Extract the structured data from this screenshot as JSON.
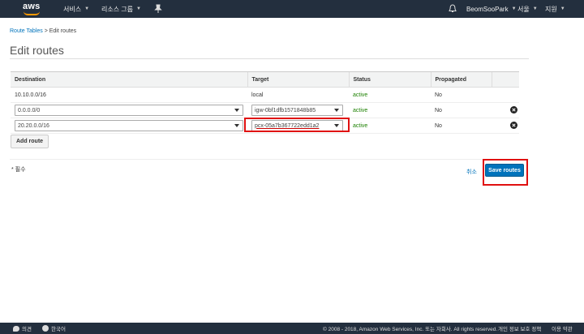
{
  "nav": {
    "logo": "aws",
    "services": "서비스",
    "resource_groups": "리소스 그룹",
    "user": "BeomSooPark",
    "region": "서울",
    "support": "지원"
  },
  "breadcrumb": {
    "link": "Route Tables",
    "current": "> Edit routes"
  },
  "page_title": "Edit routes",
  "table": {
    "headers": [
      "Destination",
      "Target",
      "Status",
      "Propagated"
    ],
    "rows": [
      {
        "destination": "10.10.0.0/16",
        "target": "local",
        "status": "active",
        "propagated": "No"
      },
      {
        "destination": "0.0.0.0/0",
        "target": "igw-0bf1dfb1571848b85",
        "status": "active",
        "propagated": "No"
      },
      {
        "destination": "20.20.0.0/16",
        "target": "pcx-05a7b367722edd1a2",
        "status": "active",
        "propagated": "No"
      }
    ]
  },
  "add_route": "Add route",
  "required_note": "* 필수",
  "cancel": "취소",
  "save_routes": "Save routes",
  "footer": {
    "feedback": "의견",
    "language": "한국어",
    "copyright": "© 2008 - 2018, Amazon Web Services, Inc. 또는 자회사. All rights reserved.",
    "privacy": "개인 정보 보호 정책",
    "terms": "이용 약관"
  },
  "colors": {
    "nav_bg": "#232f3e",
    "accent": "#0073bb",
    "active": "#1d8102",
    "highlight": "#e01010"
  }
}
